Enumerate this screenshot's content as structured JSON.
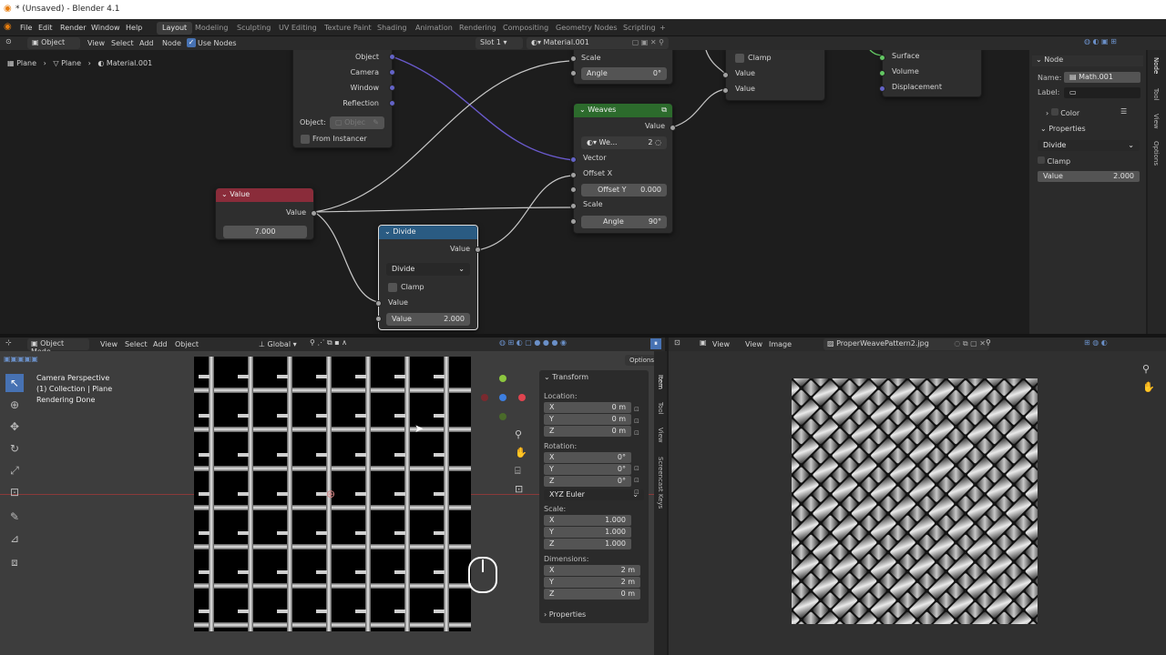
{
  "app_title": "* (Unsaved) - Blender 4.1",
  "menus": [
    "File",
    "Edit",
    "Render",
    "Window",
    "Help"
  ],
  "workspaces": [
    "Layout",
    "Modeling",
    "Sculpting",
    "UV Editing",
    "Texture Paint",
    "Shading",
    "Animation",
    "Rendering",
    "Compositing",
    "Geometry Nodes",
    "Scripting"
  ],
  "node_header": {
    "mode": "Object",
    "items": [
      "View",
      "Select",
      "Add",
      "Node"
    ],
    "use_nodes": "Use Nodes",
    "slot": "Slot 1",
    "material": "Material.001"
  },
  "breadcrumb": [
    "Plane",
    "Plane",
    "Material.001"
  ],
  "tex_node": {
    "outputs": [
      "Object",
      "Camera",
      "Window",
      "Reflection"
    ],
    "object_label": "Object:",
    "object_placeholder": "Objec",
    "from_instancer": "From Instancer"
  },
  "value_node": {
    "title": "Value",
    "output": "Value",
    "value": "7.000"
  },
  "divide_node": {
    "title": "Divide",
    "output": "Value",
    "operation": "Divide",
    "clamp": "Clamp",
    "input": "Value",
    "field_label": "Value",
    "field_value": "2.000"
  },
  "top_partial_node": {
    "scale": "Scale",
    "angle_label": "Angle",
    "angle_value": "0°"
  },
  "math_partial_node": {
    "clamp": "Clamp",
    "value1": "Value",
    "value2": "Value"
  },
  "output_node": {
    "surface": "Surface",
    "volume": "Volume",
    "displacement": "Displacement"
  },
  "weaves_node": {
    "title": "Weaves",
    "output": "Value",
    "group": "We...",
    "users": "2",
    "vector": "Vector",
    "offset_x": "Offset X",
    "offset_y_label": "Offset Y",
    "offset_y_value": "0.000",
    "scale": "Scale",
    "angle_label": "Angle",
    "angle_value": "90°"
  },
  "node_sidebar": {
    "section": "Node",
    "name_label": "Name:",
    "name_value": "Math.001",
    "label_label": "Label:",
    "color": "Color",
    "properties": "Properties",
    "operation": "Divide",
    "clamp": "Clamp",
    "value_label": "Value",
    "value_value": "2.000",
    "tabs": [
      "Node",
      "Tool",
      "View",
      "Options"
    ]
  },
  "viewport_header": {
    "mode": "Object Mode",
    "items": [
      "View",
      "Select",
      "Add",
      "Object"
    ],
    "orientation": "Global",
    "options": "Options"
  },
  "viewport_info": [
    "Camera Perspective",
    "(1) Collection | Plane",
    "Rendering Done"
  ],
  "transform": {
    "title": "Transform",
    "location": "Location:",
    "loc": [
      [
        "X",
        "0 m"
      ],
      [
        "Y",
        "0 m"
      ],
      [
        "Z",
        "0 m"
      ]
    ],
    "rotation": "Rotation:",
    "rot": [
      [
        "X",
        "0°"
      ],
      [
        "Y",
        "0°"
      ],
      [
        "Z",
        "0°"
      ]
    ],
    "euler": "XYZ Euler",
    "scale": "Scale:",
    "scl": [
      [
        "X",
        "1.000"
      ],
      [
        "Y",
        "1.000"
      ],
      [
        "Z",
        "1.000"
      ]
    ],
    "dimensions": "Dimensions:",
    "dim": [
      [
        "X",
        "2 m"
      ],
      [
        "Y",
        "2 m"
      ],
      [
        "Z",
        "0 m"
      ]
    ],
    "properties": "Properties"
  },
  "viewport_tabs": [
    "Item",
    "Tool",
    "View",
    "Screencast Keys"
  ],
  "image_header": {
    "items": [
      "View",
      "View",
      "Image"
    ],
    "image_name": "ProperWeavePattern2.jpg"
  },
  "icons": [
    "blender-logo-icon",
    "eye-icon",
    "camera-icon",
    "hand-icon",
    "magnify-icon",
    "cursor-icon",
    "move-icon",
    "rotate-icon",
    "scale-icon",
    "transform-icon",
    "annotate-icon",
    "measure-icon",
    "add-cube-icon",
    "mouse-icon",
    "pin-icon",
    "close-icon",
    "gizmo-icon"
  ]
}
